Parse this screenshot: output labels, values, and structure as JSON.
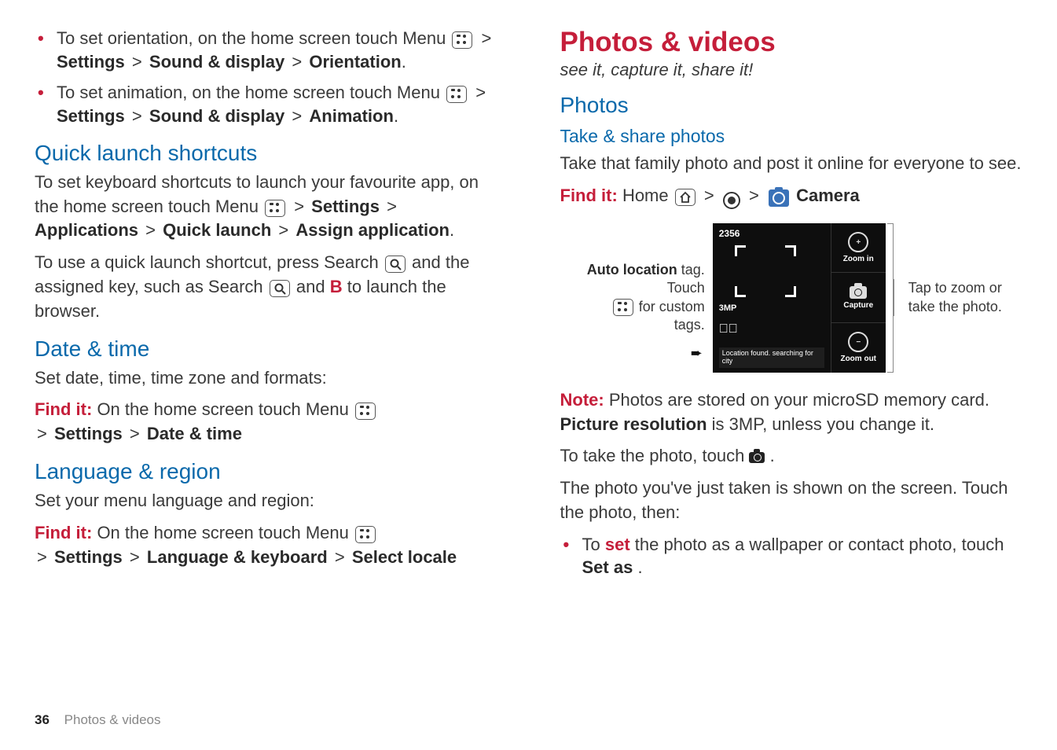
{
  "left": {
    "bullets": [
      {
        "lead": "To set orientation, on the home screen touch Menu ",
        "path": [
          "Settings",
          "Sound & display",
          "Orientation"
        ]
      },
      {
        "lead": "To set animation, on the home screen touch Menu ",
        "path": [
          "Settings",
          "Sound & display",
          "Animation"
        ]
      }
    ],
    "quick_title": "Quick launch shortcuts",
    "quick_p1a": "To set keyboard shortcuts to launch your favourite app, on the home screen touch Menu ",
    "quick_path": [
      "Settings",
      "Applications",
      "Quick launch",
      "Assign application"
    ],
    "quick_p2a": "To use a quick launch shortcut, press Search ",
    "quick_p2b": " and the assigned key, such as Search ",
    "quick_p2c": " and ",
    "quick_p2_key": "B",
    "quick_p2d": " to launch the browser.",
    "date_title": "Date & time",
    "date_p": "Set date, time, time zone and formats:",
    "date_find_pre": "On the home screen touch Menu ",
    "date_path": [
      "Settings",
      "Date & time"
    ],
    "lang_title": "Language & region",
    "lang_p": "Set your menu language and region:",
    "lang_find_pre": "On the home screen touch Menu ",
    "lang_path": [
      "Settings",
      "Language & keyboard",
      "Select locale"
    ]
  },
  "right": {
    "title": "Photos & videos",
    "tagline": "see it, capture it, share it!",
    "photos_h": "Photos",
    "take_h": "Take & share photos",
    "take_p": "Take that family photo and post it online for everyone to see.",
    "findit_home": "Home ",
    "findit_camera": "Camera",
    "camshot": {
      "count": "2356",
      "mp": "3MP",
      "loc": "Location found. searching for city",
      "zoom_in": "Zoom in",
      "capture": "Capture",
      "zoom_out": "Zoom out"
    },
    "callout_left_b": "Auto location",
    "callout_left_a": " tag. Touch ",
    "callout_left_c": " for custom tags.",
    "callout_right": "Tap to zoom or take the photo.",
    "note_p_a": "Photos are stored on your microSD memory card. ",
    "note_b": "Picture resolution",
    "note_p_b": " is 3MP, unless you change it.",
    "take_photo_a": "To take the photo, touch ",
    "take_photo_b": ".",
    "shown_p": "The photo you've just taken is shown on the screen. Touch the photo, then:",
    "bullet_set_a": "To ",
    "bullet_set_word": "set",
    "bullet_set_b": " the photo as a wallpaper or contact photo, touch ",
    "bullet_set_c": "Set as",
    "bullet_set_d": "."
  },
  "footer": {
    "page": "36",
    "section": "Photos & videos"
  },
  "labels": {
    "findit": "Find it:",
    "note": "Note:"
  }
}
